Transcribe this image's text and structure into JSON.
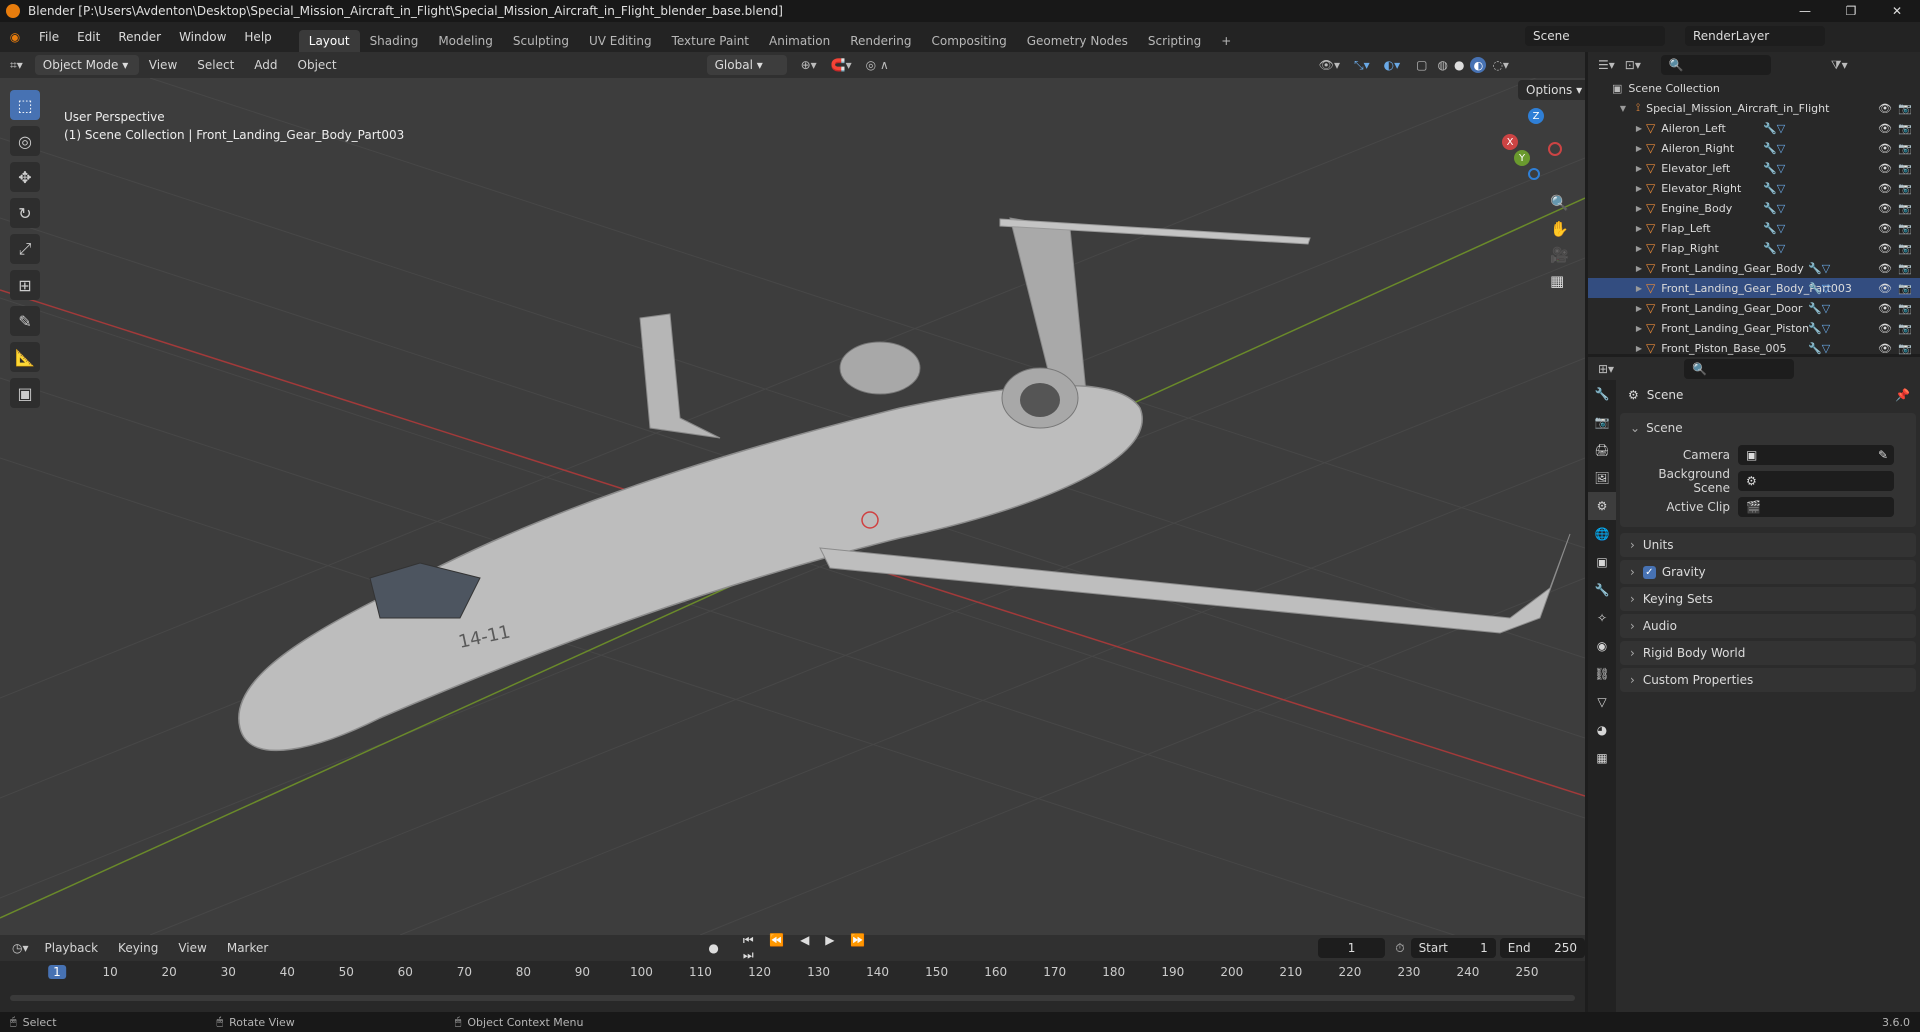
{
  "window": {
    "title": "Blender [P:\\Users\\Avdenton\\Desktop\\Special_Mission_Aircraft_in_Flight\\Special_Mission_Aircraft_in_Flight_blender_base.blend]"
  },
  "menu": {
    "file": "File",
    "edit": "Edit",
    "render": "Render",
    "window": "Window",
    "help": "Help"
  },
  "workspaces": [
    "Layout",
    "Shading",
    "Modeling",
    "Sculpting",
    "UV Editing",
    "Texture Paint",
    "Animation",
    "Rendering",
    "Compositing",
    "Geometry Nodes",
    "Scripting"
  ],
  "scene_selector": {
    "scene": "Scene",
    "layer": "RenderLayer"
  },
  "viewport_header": {
    "mode": "Object Mode",
    "view": "View",
    "select": "Select",
    "add": "Add",
    "object": "Object",
    "orientation": "Global",
    "options": "Options"
  },
  "viewport": {
    "perspective": "User Perspective",
    "context": "(1) Scene Collection | Front_Landing_Gear_Body_Part003",
    "fuselage_marking": "14-11"
  },
  "gizmo": {
    "x": "X",
    "y": "Y",
    "z": "Z"
  },
  "outliner": {
    "root": "Scene Collection",
    "collection": "Special_Mission_Aircraft_in_Flight",
    "items": [
      {
        "name": "Aileron_Left"
      },
      {
        "name": "Aileron_Right"
      },
      {
        "name": "Elevator_left"
      },
      {
        "name": "Elevator_Right"
      },
      {
        "name": "Engine_Body"
      },
      {
        "name": "Flap_Left"
      },
      {
        "name": "Flap_Right"
      },
      {
        "name": "Front_Landing_Gear_Body"
      },
      {
        "name": "Front_Landing_Gear_Body_Part003"
      },
      {
        "name": "Front_Landing_Gear_Door"
      },
      {
        "name": "Front_Landing_Gear_Piston"
      },
      {
        "name": "Front_Piston_Base_005"
      }
    ]
  },
  "properties": {
    "context": "Scene",
    "section": "Scene",
    "camera_label": "Camera",
    "bg_scene_label": "Background Scene",
    "active_clip_label": "Active Clip",
    "panels": [
      "Units",
      "Gravity",
      "Keying Sets",
      "Audio",
      "Rigid Body World",
      "Custom Properties"
    ]
  },
  "timeline": {
    "playback": "Playback",
    "keying": "Keying",
    "view": "View",
    "marker": "Marker",
    "current_frame": "1",
    "start_label": "Start",
    "start": "1",
    "end_label": "End",
    "end": "250",
    "ticks": [
      "1",
      "10",
      "20",
      "30",
      "40",
      "50",
      "60",
      "70",
      "80",
      "90",
      "100",
      "110",
      "120",
      "130",
      "140",
      "150",
      "160",
      "170",
      "180",
      "190",
      "200",
      "210",
      "220",
      "230",
      "240",
      "250"
    ]
  },
  "status": {
    "select": "Select",
    "rotate": "Rotate View",
    "context_menu": "Object Context Menu",
    "version": "3.6.0"
  },
  "colors": {
    "accent": "#4772b3",
    "mesh": "#e8893a",
    "x_axis": "#b34444",
    "y_axis": "#6a9a2e",
    "z_axis": "#2f7fd6"
  }
}
